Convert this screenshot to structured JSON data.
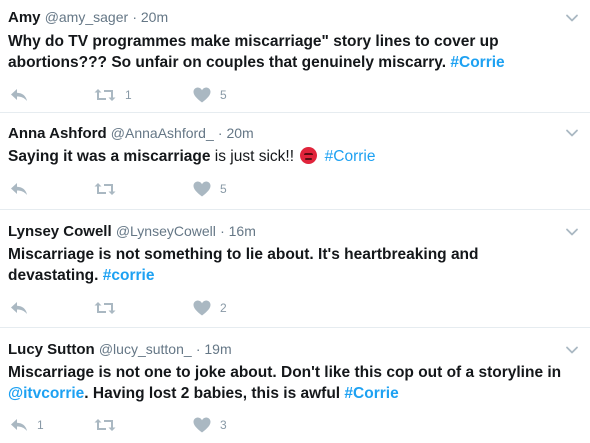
{
  "tweets": [
    {
      "name": "Amy",
      "handle": "@amy_sager",
      "time": "· 20m",
      "text": "Why do TV programmes make miscarriage\" story lines to cover up abortions??? So unfair on couples that genuinely miscarry. ",
      "hashtag": "#Corrie",
      "retweets": "1",
      "likes": "5"
    },
    {
      "name": "Anna Ashford",
      "handle": "@AnnaAshford_",
      "time": "· 20m",
      "text_bold": "Saying it was a miscarriage",
      "text_normal": " is just sick!! ",
      "emoji": "angry-face",
      "hashtag": "#Corrie",
      "likes": "5"
    },
    {
      "name": "Lynsey Cowell",
      "handle": "@LynseyCowell",
      "time": "· 16m",
      "text": "Miscarriage is not something to lie about. It's heartbreaking and devastating. ",
      "hashtag": "#corrie",
      "likes": "2"
    },
    {
      "name": "Lucy Sutton",
      "handle": "@lucy_sutton_",
      "time": "· 19m",
      "text_line1": "Miscarriage is not one to joke about. Don't like this cop out of a storyline in",
      "mention": "@itvcorrie",
      "text_line2": ". Having lost 2 babies, this is awful ",
      "hashtag": "#Corrie",
      "replies": "1",
      "likes": "3"
    }
  ],
  "colors": {
    "link": "#1da1f2",
    "icon": "#aab8c2",
    "muted": "#657786"
  },
  "icons": [
    "reply-icon",
    "retweet-icon",
    "like-icon",
    "chevron-down-icon"
  ]
}
